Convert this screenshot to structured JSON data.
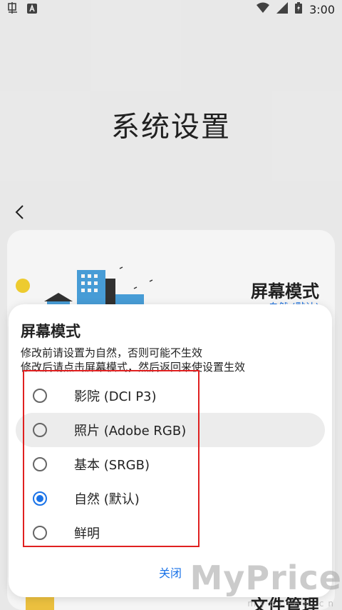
{
  "status_bar": {
    "time": "3:00",
    "left_icons": [
      "notification-app-icon",
      "a-badge-icon"
    ],
    "right_icons": [
      "wifi-icon",
      "signal-icon",
      "battery-icon"
    ]
  },
  "page": {
    "title": "系统设置",
    "card_title": "屏幕模式",
    "card_subtitle": "自然 (默认)",
    "bottom_item": "文件管理"
  },
  "dialog": {
    "title": "屏幕模式",
    "description_line1": "修改前请设置为自然，否则可能不生效",
    "description_line2": "修改后请点击屏幕模式，然后返回来使设置生效",
    "options": [
      {
        "label": "影院 (DCI P3)",
        "checked": false
      },
      {
        "label": "照片 (Adobe RGB)",
        "checked": false
      },
      {
        "label": "基本 (SRGB)",
        "checked": false
      },
      {
        "label": "自然 (默认)",
        "checked": true
      },
      {
        "label": "鲜明",
        "checked": false
      }
    ],
    "close_label": "关闭"
  },
  "watermark": {
    "text": "MyPrice",
    "sub": "myprice.cn"
  },
  "colors": {
    "accent": "#1a73e8",
    "highlight_border": "#e02020",
    "background": "#f2f2f2"
  }
}
